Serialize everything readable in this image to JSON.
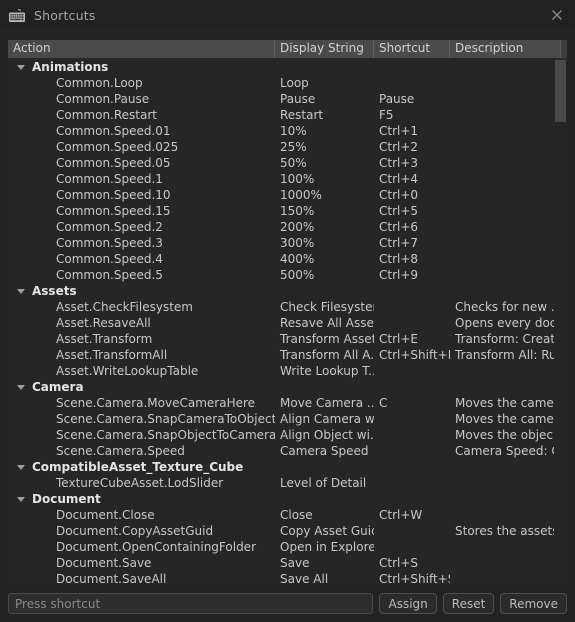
{
  "window": {
    "title": "Shortcuts",
    "icon": "keyboard-icon",
    "close_label": "✕"
  },
  "table": {
    "columns": [
      {
        "key": "action",
        "label": "Action"
      },
      {
        "key": "display",
        "label": "Display String"
      },
      {
        "key": "shortcut",
        "label": "Shortcut"
      },
      {
        "key": "description",
        "label": "Description"
      }
    ],
    "groups": [
      {
        "name": "Animations",
        "expanded": true,
        "rows": [
          {
            "action": "Common.Loop",
            "display": "Loop",
            "shortcut": "",
            "description": ""
          },
          {
            "action": "Common.Pause",
            "display": "Pause",
            "shortcut": "Pause",
            "description": ""
          },
          {
            "action": "Common.Restart",
            "display": "Restart",
            "shortcut": "F5",
            "description": ""
          },
          {
            "action": "Common.Speed.01",
            "display": "10%",
            "shortcut": "Ctrl+1",
            "description": ""
          },
          {
            "action": "Common.Speed.025",
            "display": "25%",
            "shortcut": "Ctrl+2",
            "description": ""
          },
          {
            "action": "Common.Speed.05",
            "display": "50%",
            "shortcut": "Ctrl+3",
            "description": ""
          },
          {
            "action": "Common.Speed.1",
            "display": "100%",
            "shortcut": "Ctrl+4",
            "description": ""
          },
          {
            "action": "Common.Speed.10",
            "display": "1000%",
            "shortcut": "Ctrl+0",
            "description": ""
          },
          {
            "action": "Common.Speed.15",
            "display": "150%",
            "shortcut": "Ctrl+5",
            "description": ""
          },
          {
            "action": "Common.Speed.2",
            "display": "200%",
            "shortcut": "Ctrl+6",
            "description": ""
          },
          {
            "action": "Common.Speed.3",
            "display": "300%",
            "shortcut": "Ctrl+7",
            "description": ""
          },
          {
            "action": "Common.Speed.4",
            "display": "400%",
            "shortcut": "Ctrl+8",
            "description": ""
          },
          {
            "action": "Common.Speed.5",
            "display": "500%",
            "shortcut": "Ctrl+9",
            "description": ""
          }
        ]
      },
      {
        "name": "Assets",
        "expanded": true,
        "rows": [
          {
            "action": "Asset.CheckFilesystem",
            "display": "Check Filesystem",
            "shortcut": "",
            "description": "Checks for new ..."
          },
          {
            "action": "Asset.ResaveAll",
            "display": "Resave All Assets",
            "shortcut": "",
            "description": "Opens every doc..."
          },
          {
            "action": "Asset.Transform",
            "display": "Transform Asset",
            "shortcut": "Ctrl+E",
            "description": "Transform: Creat..."
          },
          {
            "action": "Asset.TransformAll",
            "display": "Transform All A...",
            "shortcut": "Ctrl+Shift+E",
            "description": "Transform All: Ru..."
          },
          {
            "action": "Asset.WriteLookupTable",
            "display": "Write Lookup T...",
            "shortcut": "",
            "description": ""
          }
        ]
      },
      {
        "name": "Camera",
        "expanded": true,
        "rows": [
          {
            "action": "Scene.Camera.MoveCameraHere",
            "display": "Move Camera ...",
            "shortcut": "C",
            "description": "Moves the came..."
          },
          {
            "action": "Scene.Camera.SnapCameraToObject",
            "display": "Align Camera w...",
            "shortcut": "",
            "description": "Moves the came..."
          },
          {
            "action": "Scene.Camera.SnapObjectToCamera",
            "display": "Align Object wi...",
            "shortcut": "",
            "description": "Moves the objec..."
          },
          {
            "action": "Scene.Camera.Speed",
            "display": "Camera Speed",
            "shortcut": "",
            "description": "Camera Speed: C..."
          }
        ]
      },
      {
        "name": "CompatibleAsset_Texture_Cube",
        "expanded": true,
        "rows": [
          {
            "action": "TextureCubeAsset.LodSlider",
            "display": "Level of Detail",
            "shortcut": "",
            "description": ""
          }
        ]
      },
      {
        "name": "Document",
        "expanded": true,
        "rows": [
          {
            "action": "Document.Close",
            "display": "Close",
            "shortcut": "Ctrl+W",
            "description": ""
          },
          {
            "action": "Document.CopyAssetGuid",
            "display": "Copy Asset Guid",
            "shortcut": "",
            "description": "Stores the assets ..."
          },
          {
            "action": "Document.OpenContainingFolder",
            "display": "Open in Explorer",
            "shortcut": "",
            "description": ""
          },
          {
            "action": "Document.Save",
            "display": "Save",
            "shortcut": "Ctrl+S",
            "description": ""
          },
          {
            "action": "Document.SaveAll",
            "display": "Save All",
            "shortcut": "Ctrl+Shift+S",
            "description": ""
          }
        ]
      }
    ]
  },
  "bottom": {
    "input_value": "",
    "input_placeholder": "Press shortcut",
    "assign_label": "Assign",
    "reset_label": "Reset",
    "remove_label": "Remove"
  },
  "colors": {
    "window_bg": "#232323",
    "titlebar_bg": "#212121",
    "header_bg": "#4a4a4a",
    "body_bg": "#262626",
    "text": "#c8c8c8",
    "group_text": "#e4e4e4",
    "scroll_thumb": "#4a4a4a"
  }
}
